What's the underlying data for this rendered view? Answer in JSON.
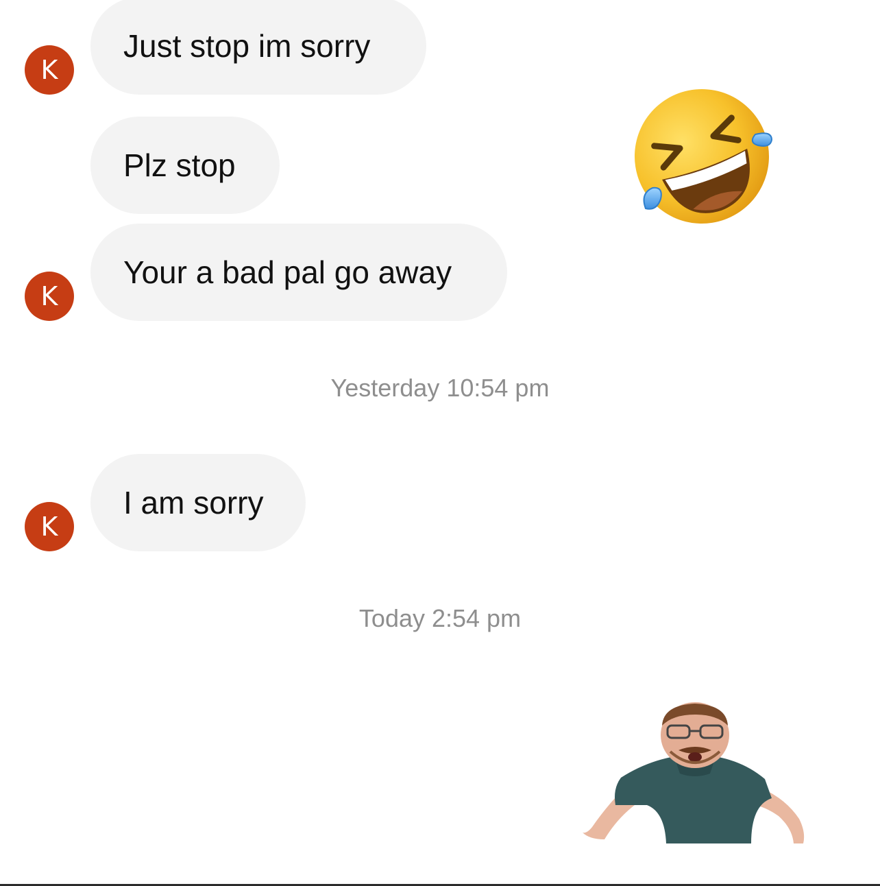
{
  "messages": [
    {
      "text": "Just stop im sorry",
      "avatar": "K"
    },
    {
      "text": "Plz stop"
    },
    {
      "text": "Your a bad pal go away",
      "avatar": "K"
    },
    {
      "text": "I am sorry",
      "avatar": "K"
    }
  ],
  "timestamps": {
    "first": "Yesterday 10:54 pm",
    "second": "Today 2:54 pm"
  },
  "reaction_emoji": "rolling-on-floor-laughing-icon",
  "sticker": "person-sticker",
  "colors": {
    "avatar": "#c63d14",
    "bubble": "#f3f3f3",
    "timestamp": "#8e8e8e"
  }
}
